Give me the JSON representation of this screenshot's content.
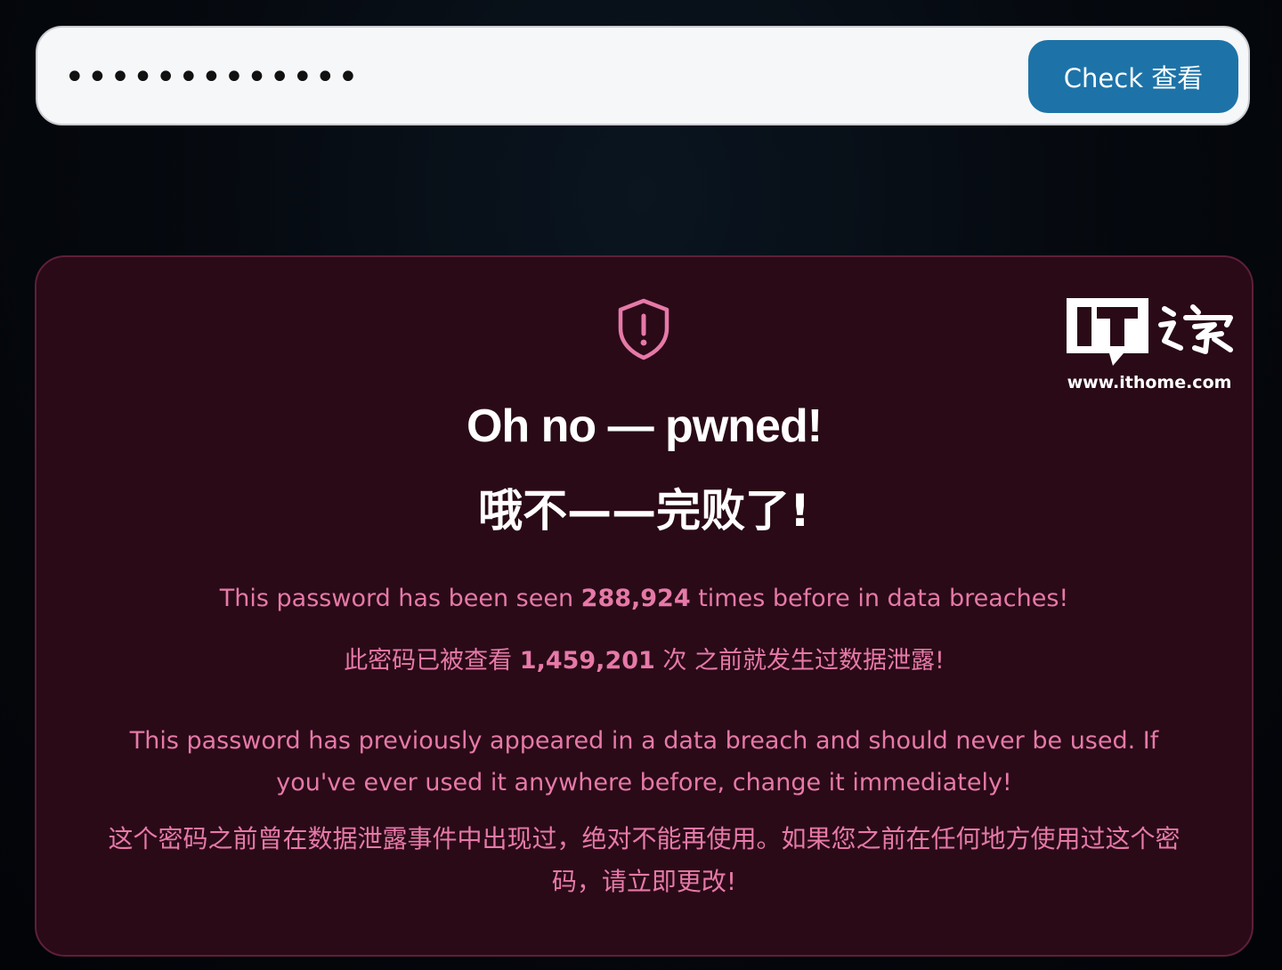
{
  "search": {
    "password_value": "•••••••••••••",
    "check_label": "Check 查看"
  },
  "result": {
    "icon": "shield-exclamation-icon",
    "title_en": "Oh no — pwned!",
    "title_zh": "哦不——完败了!",
    "seen_en_before": "This password has been seen ",
    "seen_en_count": "288,924",
    "seen_en_after": " times before in data breaches!",
    "seen_zh_before": "此密码已被查看 ",
    "seen_zh_count": "1,459,201",
    "seen_zh_after": " 次 之前就发生过数据泄露!",
    "warning_en": "This password has previously appeared in a data breach and should never be used. If you've ever used it anywhere before, change it immediately!",
    "warning_zh": "这个密码之前曾在数据泄露事件中出现过，绝对不能再使用。如果您之前在任何地方使用过这个密码，请立即更改!"
  },
  "watermark": {
    "logo_text": "IT之家",
    "url": "www.ithome.com"
  },
  "colors": {
    "background": "#04070c",
    "button": "#1d73a8",
    "panel": "#2a0a17",
    "panel_border": "#5e2039",
    "accent_pink": "#e679a8"
  }
}
